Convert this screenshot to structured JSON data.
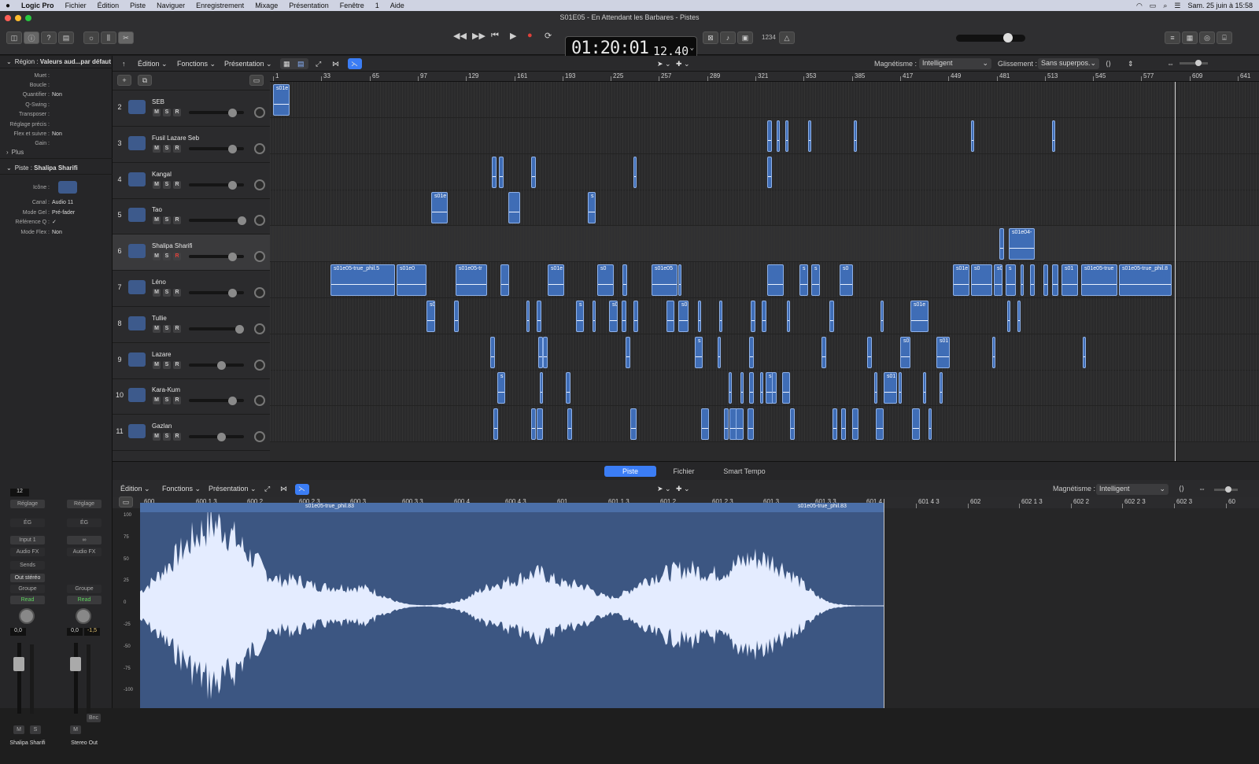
{
  "menubar": {
    "apple": "",
    "app": "Logic Pro",
    "items": [
      "Fichier",
      "Édition",
      "Piste",
      "Naviguer",
      "Enregistrement",
      "Mixage",
      "Présentation",
      "Fenêtre",
      "1",
      "Aide"
    ],
    "clock": "Sam. 25 juin à 15:58"
  },
  "window": {
    "title": "S01E05 - En Attendant les Barbares - Pistes"
  },
  "lcd": {
    "time": "01:20:01",
    "frames": "12.40",
    "ratio": "1234"
  },
  "inspector": {
    "region_label": "Région :",
    "region_value": "Valeurs aud...par défaut",
    "rows": [
      {
        "k": "Muet :",
        "v": ""
      },
      {
        "k": "Boucle :",
        "v": ""
      },
      {
        "k": "Quantifier :",
        "v": "Non"
      },
      {
        "k": "Q-Swing :",
        "v": ""
      },
      {
        "k": "Transposer :",
        "v": ""
      },
      {
        "k": "Réglage précis :",
        "v": ""
      },
      {
        "k": "Flex et suivre :",
        "v": "Non"
      },
      {
        "k": "Gain :",
        "v": ""
      }
    ],
    "plus": "Plus",
    "track_label": "Piste :",
    "track_value": "Shalipa Sharifi",
    "track_rows": [
      {
        "k": "Icône :",
        "v": ""
      },
      {
        "k": "Canal :",
        "v": "Audio 11"
      },
      {
        "k": "Mode Gel :",
        "v": "Pré-fader"
      },
      {
        "k": "Référence Q :",
        "v": "✓"
      },
      {
        "k": "Mode Flex :",
        "v": "Non"
      }
    ],
    "strip1": {
      "num": "12",
      "setting": "Réglage",
      "eq": "ÉG",
      "input": "Input 1",
      "fx": "Audio FX",
      "sends": "Sends",
      "out": "Out stéréo",
      "group": "Groupe",
      "read": "Read",
      "vol": "0,0",
      "name": "Shalipa Sharifi",
      "m": "M",
      "s": "S"
    },
    "strip2": {
      "setting": "Réglage",
      "eq": "ÉG",
      "fx": "Audio FX",
      "group": "Groupe",
      "read": "Read",
      "vol": "0,0",
      "vol2": "-1,5",
      "name": "Stereo Out",
      "m": "M",
      "bnc": "Bnc"
    }
  },
  "toolbar": {
    "edit": "Édition",
    "functions": "Fonctions",
    "view": "Présentation",
    "snap_label": "Magnétisme :",
    "snap_value": "Intelligent",
    "drag_label": "Glissement :",
    "drag_value": "Sans superpos."
  },
  "ruler": [
    "1",
    "33",
    "65",
    "97",
    "129",
    "161",
    "193",
    "225",
    "257",
    "289",
    "321",
    "353",
    "385",
    "417",
    "449",
    "481",
    "513",
    "545",
    "577",
    "609",
    "641"
  ],
  "tracks": [
    {
      "num": "2",
      "name": "SEB",
      "rec": false,
      "vol": 0.78
    },
    {
      "num": "3",
      "name": "Fusil Lazare Seb",
      "rec": false,
      "vol": 0.78
    },
    {
      "num": "4",
      "name": "Kangal",
      "rec": false,
      "vol": 0.78
    },
    {
      "num": "5",
      "name": "Tao",
      "rec": false,
      "vol": 0.95
    },
    {
      "num": "6",
      "name": "Shalipa Sharifi",
      "rec": true,
      "vol": 0.78
    },
    {
      "num": "7",
      "name": "Léno",
      "rec": false,
      "vol": 0.78
    },
    {
      "num": "8",
      "name": "Tullie",
      "rec": false,
      "vol": 0.92
    },
    {
      "num": "9",
      "name": "Lazare",
      "rec": false,
      "vol": 0.58
    },
    {
      "num": "10",
      "name": "Kara-Kum",
      "rec": false,
      "vol": 0.78
    },
    {
      "num": "11",
      "name": "Gazlan",
      "rec": false,
      "vol": 0.58
    }
  ],
  "track_buttons": {
    "m": "M",
    "s": "S",
    "r": "R"
  },
  "regions": [
    [
      {
        "s": 1,
        "l": 11,
        "t": "s01e"
      }
    ],
    [
      {
        "s": 329,
        "l": 3
      },
      {
        "s": 335,
        "l": 2
      },
      {
        "s": 341,
        "l": 2
      },
      {
        "s": 356,
        "l": 2
      },
      {
        "s": 386,
        "l": 2
      },
      {
        "s": 464,
        "l": 2
      },
      {
        "s": 518,
        "l": 2
      }
    ],
    [
      {
        "s": 146,
        "l": 3
      },
      {
        "s": 151,
        "l": 3
      },
      {
        "s": 172,
        "l": 3
      },
      {
        "s": 240,
        "l": 2
      },
      {
        "s": 329,
        "l": 3
      }
    ],
    [
      {
        "s": 106,
        "l": 11,
        "t": "s01e"
      },
      {
        "s": 157,
        "l": 8
      },
      {
        "s": 210,
        "l": 5,
        "t": "s"
      }
    ],
    [
      {
        "s": 483,
        "l": 3
      },
      {
        "s": 489,
        "l": 17,
        "t": "s01e04-"
      }
    ],
    [
      {
        "s": 39,
        "l": 43,
        "t": "s01e05-true_phil.5"
      },
      {
        "s": 83,
        "l": 20,
        "t": "s01e0"
      },
      {
        "s": 122,
        "l": 21,
        "t": "s01e05-tr"
      },
      {
        "s": 152,
        "l": 6
      },
      {
        "s": 183,
        "l": 11,
        "t": "s01e"
      },
      {
        "s": 216,
        "l": 11,
        "t": "s0"
      },
      {
        "s": 233,
        "l": 3
      },
      {
        "s": 252,
        "l": 17,
        "t": "s01e05"
      },
      {
        "s": 270,
        "l": 2
      },
      {
        "s": 329,
        "l": 11
      },
      {
        "s": 350,
        "l": 6,
        "t": "s"
      },
      {
        "s": 358,
        "l": 6,
        "t": "s"
      },
      {
        "s": 377,
        "l": 9,
        "t": "s0"
      },
      {
        "s": 452,
        "l": 11,
        "t": "s01e"
      },
      {
        "s": 464,
        "l": 14,
        "t": "s0"
      },
      {
        "s": 479,
        "l": 6,
        "t": "s0"
      },
      {
        "s": 487,
        "l": 7,
        "t": "s"
      },
      {
        "s": 497,
        "l": 2
      },
      {
        "s": 503,
        "l": 3
      },
      {
        "s": 512,
        "l": 3
      },
      {
        "s": 518,
        "l": 4
      },
      {
        "s": 524,
        "l": 11,
        "t": "s01"
      },
      {
        "s": 537,
        "l": 24,
        "t": "s01e05-true"
      },
      {
        "s": 562,
        "l": 35,
        "t": "s01e05-true_phil.8"
      }
    ],
    [
      {
        "s": 103,
        "l": 6,
        "t": "s0"
      },
      {
        "s": 121,
        "l": 3
      },
      {
        "s": 169,
        "l": 2
      },
      {
        "s": 176,
        "l": 3
      },
      {
        "s": 202,
        "l": 5,
        "t": "s"
      },
      {
        "s": 213,
        "l": 2
      },
      {
        "s": 224,
        "l": 6,
        "t": "s0"
      },
      {
        "s": 232,
        "l": 3
      },
      {
        "s": 240,
        "l": 3
      },
      {
        "s": 262,
        "l": 5
      },
      {
        "s": 270,
        "l": 7,
        "t": "s0"
      },
      {
        "s": 283,
        "l": 2
      },
      {
        "s": 297,
        "l": 2
      },
      {
        "s": 318,
        "l": 3
      },
      {
        "s": 325,
        "l": 3
      },
      {
        "s": 342,
        "l": 2
      },
      {
        "s": 370,
        "l": 3
      },
      {
        "s": 404,
        "l": 2
      },
      {
        "s": 424,
        "l": 12,
        "t": "s01e"
      },
      {
        "s": 488,
        "l": 2
      },
      {
        "s": 495,
        "l": 2
      }
    ],
    [
      {
        "s": 145,
        "l": 3
      },
      {
        "s": 177,
        "l": 3
      },
      {
        "s": 180,
        "l": 3
      },
      {
        "s": 235,
        "l": 3
      },
      {
        "s": 281,
        "l": 5,
        "t": "s"
      },
      {
        "s": 296,
        "l": 2
      },
      {
        "s": 317,
        "l": 3
      },
      {
        "s": 365,
        "l": 3
      },
      {
        "s": 395,
        "l": 3
      },
      {
        "s": 417,
        "l": 7,
        "t": "s0"
      },
      {
        "s": 441,
        "l": 9,
        "t": "s01"
      },
      {
        "s": 478,
        "l": 2
      },
      {
        "s": 538,
        "l": 2
      }
    ],
    [
      {
        "s": 150,
        "l": 5,
        "t": "s"
      },
      {
        "s": 178,
        "l": 2
      },
      {
        "s": 195,
        "l": 3
      },
      {
        "s": 303,
        "l": 2
      },
      {
        "s": 311,
        "l": 2
      },
      {
        "s": 317,
        "l": 3
      },
      {
        "s": 324,
        "l": 2
      },
      {
        "s": 328,
        "l": 5,
        "t": "s"
      },
      {
        "s": 332,
        "l": 3
      },
      {
        "s": 339,
        "l": 5
      },
      {
        "s": 400,
        "l": 2
      },
      {
        "s": 406,
        "l": 9,
        "t": "s01"
      },
      {
        "s": 416,
        "l": 2
      },
      {
        "s": 443,
        "l": 2
      },
      {
        "s": 432,
        "l": 2
      }
    ],
    [
      {
        "s": 147,
        "l": 3
      },
      {
        "s": 172,
        "l": 3
      },
      {
        "s": 176,
        "l": 4
      },
      {
        "s": 196,
        "l": 3
      },
      {
        "s": 238,
        "l": 4
      },
      {
        "s": 285,
        "l": 5
      },
      {
        "s": 300,
        "l": 3
      },
      {
        "s": 304,
        "l": 5
      },
      {
        "s": 308,
        "l": 5
      },
      {
        "s": 316,
        "l": 4
      },
      {
        "s": 344,
        "l": 3
      },
      {
        "s": 372,
        "l": 3
      },
      {
        "s": 378,
        "l": 3
      },
      {
        "s": 385,
        "l": 4
      },
      {
        "s": 401,
        "l": 5
      },
      {
        "s": 425,
        "l": 5
      },
      {
        "s": 436,
        "l": 2
      }
    ]
  ],
  "lower_tabs": [
    "Piste",
    "Fichier",
    "Smart Tempo"
  ],
  "lower_ruler": [
    "600",
    "600 1 3",
    "600 2",
    "600 2 3",
    "600 3",
    "600 3 3",
    "600 4",
    "600 4 3",
    "601",
    "601 1 3",
    "601 2",
    "601 2 3",
    "601 3",
    "601 3 3",
    "601 4",
    "601 4 3",
    "602",
    "602 1 3",
    "602 2",
    "602 2 3",
    "602 3",
    "60"
  ],
  "editor": {
    "region1": "s01e05-true_phil.83",
    "region2": "s01e05-true_phil.83",
    "scale": [
      "100",
      "75",
      "50",
      "25",
      "0",
      "-25",
      "-50",
      "-75",
      "-100"
    ]
  },
  "colors": {
    "region": "#3f6db6",
    "accent": "#3b7df5"
  }
}
